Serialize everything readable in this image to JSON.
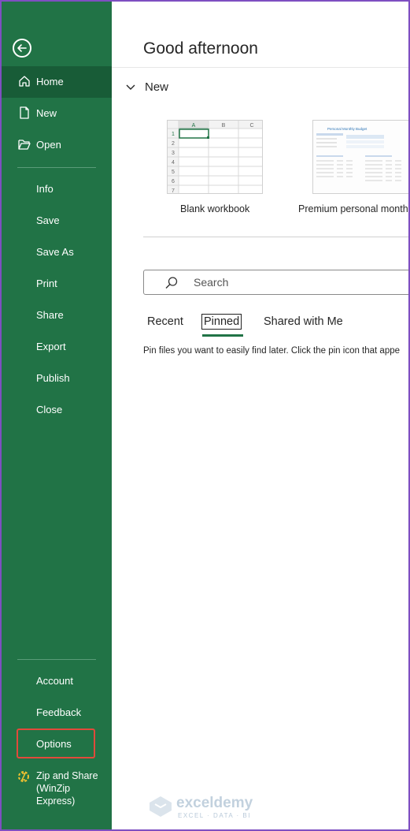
{
  "sidebar": {
    "back_icon": "arrow-left-circle-icon",
    "top_items": [
      {
        "label": "Home",
        "icon": "home-icon",
        "active": true
      },
      {
        "label": "New",
        "icon": "new-document-icon"
      },
      {
        "label": "Open",
        "icon": "folder-open-icon"
      }
    ],
    "mid_items": [
      "Info",
      "Save",
      "Save As",
      "Print",
      "Share",
      "Export",
      "Publish",
      "Close"
    ],
    "bottom_items": [
      "Account",
      "Feedback",
      "Options"
    ],
    "zip_label": "Zip and Share (WinZip Express)",
    "zip_icon": "winzip-icon",
    "colors": {
      "bg": "#217346",
      "active": "#185c37",
      "highlight": "#e14a3b"
    }
  },
  "main": {
    "greeting": "Good afternoon",
    "new_section": "New",
    "templates": [
      {
        "label": "Blank workbook",
        "columns": [
          "A",
          "B",
          "C"
        ],
        "rows": [
          "1",
          "2",
          "3",
          "4",
          "5",
          "6",
          "7"
        ]
      },
      {
        "label": "Premium personal monthly",
        "title": "Personal Monthly Budget"
      }
    ],
    "search": {
      "placeholder": "Search",
      "icon": "search-icon"
    },
    "tabs": [
      {
        "label": "Recent"
      },
      {
        "label": "Pinned",
        "active": true
      },
      {
        "label": "Shared with Me"
      }
    ],
    "pinned_hint": "Pin files you want to easily find later. Click the pin icon that appe"
  },
  "watermark": {
    "name": "exceldemy",
    "tagline": "EXCEL · DATA · BI"
  }
}
